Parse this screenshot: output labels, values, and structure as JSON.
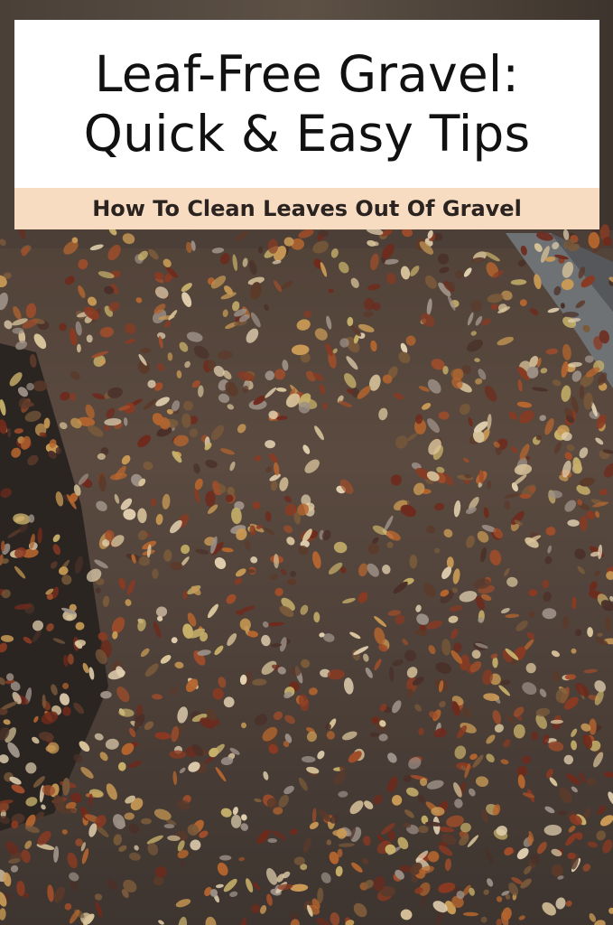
{
  "title": {
    "line1": "Leaf-Free Gravel:",
    "line2": "Quick & Easy Tips"
  },
  "subtitle": "How To Clean Leaves Out Of Gravel",
  "colors": {
    "title_panel": "#ffffff",
    "subtitle_band": "#f7dcc2",
    "title_text": "#111111",
    "subtitle_text": "#2a2320"
  },
  "scene": {
    "description_icon": "leaf-covered-gravel-photo"
  }
}
